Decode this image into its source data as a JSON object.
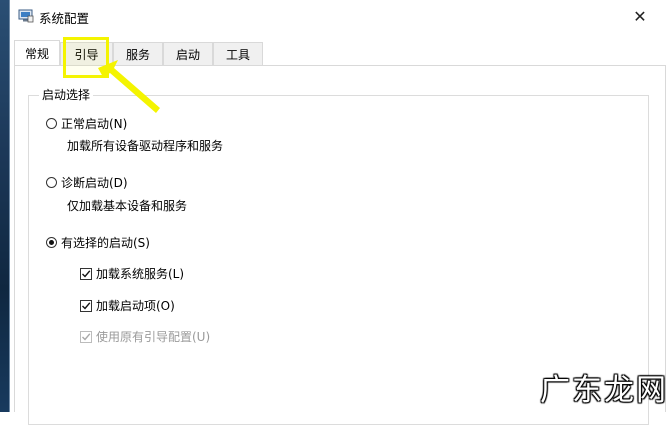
{
  "window": {
    "title": "系统配置",
    "close_glyph": "✕"
  },
  "tabs": [
    {
      "label": "常规",
      "active": true
    },
    {
      "label": "引导",
      "active": false
    },
    {
      "label": "服务",
      "active": false
    },
    {
      "label": "启动",
      "active": false
    },
    {
      "label": "工具",
      "active": false
    }
  ],
  "startup": {
    "group_label": "启动选择",
    "normal": {
      "label": "正常启动(N)",
      "desc": "加载所有设备驱动程序和服务",
      "selected": false
    },
    "diagnostic": {
      "label": "诊断启动(D)",
      "desc": "仅加载基本设备和服务",
      "selected": false
    },
    "selective": {
      "label": "有选择的启动(S)",
      "selected": true,
      "options": [
        {
          "label": "加载系统服务(L)",
          "checked": true,
          "disabled": false
        },
        {
          "label": "加载启动项(O)",
          "checked": true,
          "disabled": false
        },
        {
          "label": "使用原有引导配置(U)",
          "checked": true,
          "disabled": true
        }
      ]
    }
  },
  "annotation": {
    "highlight_color": "#f4f400"
  },
  "watermark": {
    "text": "广东龙网"
  }
}
